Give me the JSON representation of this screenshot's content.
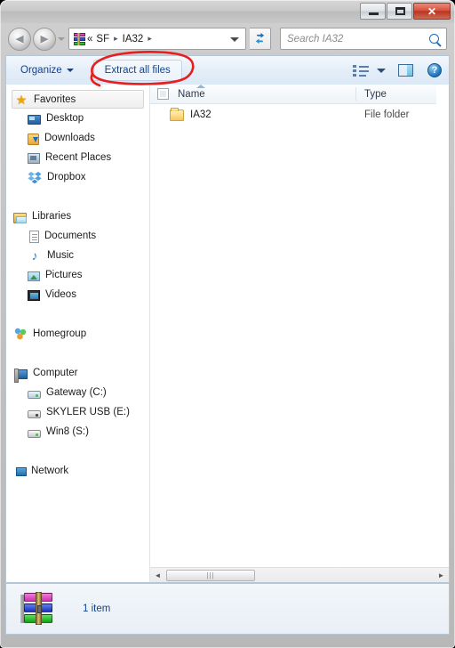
{
  "window": {
    "buttons": {
      "minimize": "Minimize",
      "maximize": "Maximize",
      "close": "✕"
    }
  },
  "addressbar": {
    "back_label": "◄",
    "forward_label": "►",
    "icon": "winrar-archive-icon",
    "crumbs": [
      "«",
      "SF",
      "IA32"
    ],
    "separator": "▸",
    "dropdown": "chevron-down-icon",
    "refresh_label": "↻"
  },
  "search": {
    "placeholder": "Search IA32",
    "icon": "search-icon"
  },
  "toolbar": {
    "organize_label": "Organize",
    "extract_label": "Extract all files",
    "view_icon": "view-options-icon",
    "pane_icon": "preview-pane-icon",
    "help_icon": "help-icon",
    "help_glyph": "?"
  },
  "sidebar": {
    "groups": [
      {
        "header": {
          "label": "Favorites",
          "icon": "star-icon",
          "selected": true
        },
        "items": [
          {
            "label": "Desktop",
            "icon": "desktop-icon"
          },
          {
            "label": "Downloads",
            "icon": "downloads-icon"
          },
          {
            "label": "Recent Places",
            "icon": "recent-places-icon"
          },
          {
            "label": "Dropbox",
            "icon": "dropbox-icon"
          }
        ]
      },
      {
        "header": {
          "label": "Libraries",
          "icon": "libraries-icon",
          "selected": false
        },
        "items": [
          {
            "label": "Documents",
            "icon": "documents-icon"
          },
          {
            "label": "Music",
            "icon": "music-icon"
          },
          {
            "label": "Pictures",
            "icon": "pictures-icon"
          },
          {
            "label": "Videos",
            "icon": "videos-icon"
          }
        ]
      },
      {
        "header": {
          "label": "Homegroup",
          "icon": "homegroup-icon",
          "selected": false
        },
        "items": []
      },
      {
        "header": {
          "label": "Computer",
          "icon": "computer-icon",
          "selected": false
        },
        "items": [
          {
            "label": "Gateway (C:)",
            "icon": "hard-drive-icon"
          },
          {
            "label": "SKYLER USB (E:)",
            "icon": "usb-drive-icon"
          },
          {
            "label": "Win8 (S:)",
            "icon": "hard-drive-icon"
          }
        ]
      },
      {
        "header": {
          "label": "Network",
          "icon": "network-icon",
          "selected": false
        },
        "items": []
      }
    ]
  },
  "filelist": {
    "columns": [
      {
        "key": "name",
        "label": "Name"
      },
      {
        "key": "type",
        "label": "Type"
      }
    ],
    "sort": "ascending",
    "rows": [
      {
        "name": "IA32",
        "type": "File folder",
        "icon": "folder-icon"
      }
    ]
  },
  "scrollbar": {
    "left_arrow": "◄",
    "right_arrow": "►",
    "grip": "|||"
  },
  "statusbar": {
    "icon": "winrar-archive-icon",
    "text": "1 item"
  },
  "annotation": {
    "color": "#e81d1d",
    "shape": "hand-drawn-ellipse",
    "target": "Extract all files"
  }
}
